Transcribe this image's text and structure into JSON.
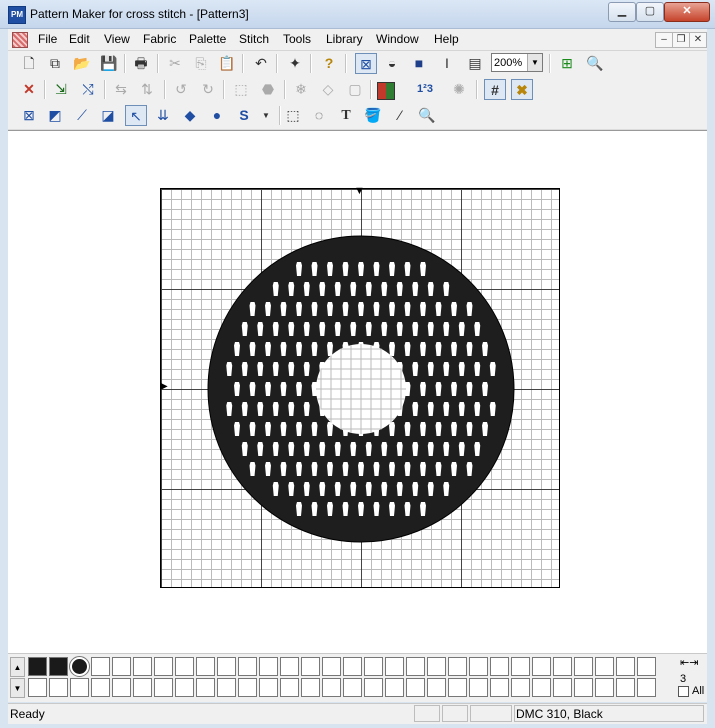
{
  "window": {
    "title": "Pattern Maker for cross stitch - [Pattern3]",
    "app_icon_text": "PM",
    "min_label": "▁",
    "max_label": "▢",
    "close_label": "✕"
  },
  "menu": {
    "items": [
      "File",
      "Edit",
      "View",
      "Fabric",
      "Palette",
      "Stitch",
      "Tools",
      "Library",
      "Window",
      "Help"
    ],
    "mdi_min": "‒",
    "mdi_restore": "❐",
    "mdi_close": "✕"
  },
  "toolbar1": {
    "zoom_value": "200%",
    "zoom_arrow": "▼",
    "text_tool": "I"
  },
  "toolbar2": {
    "numbers_icon_text": "1²3"
  },
  "toolbar3": {
    "special_stitch_text": "S",
    "text_tool": "T"
  },
  "grid": {
    "top_marker": "▼",
    "left_marker": "▶"
  },
  "palette": {
    "scroll_up": "▲",
    "scroll_down": "▼",
    "count": "3",
    "all_label": "All",
    "arrows": "⇤⇥"
  },
  "status": {
    "text": "Ready",
    "color": "DMC  310, Black"
  },
  "colors": {
    "stitch": "#1e1e1e",
    "accent": "#1f4ea3"
  }
}
